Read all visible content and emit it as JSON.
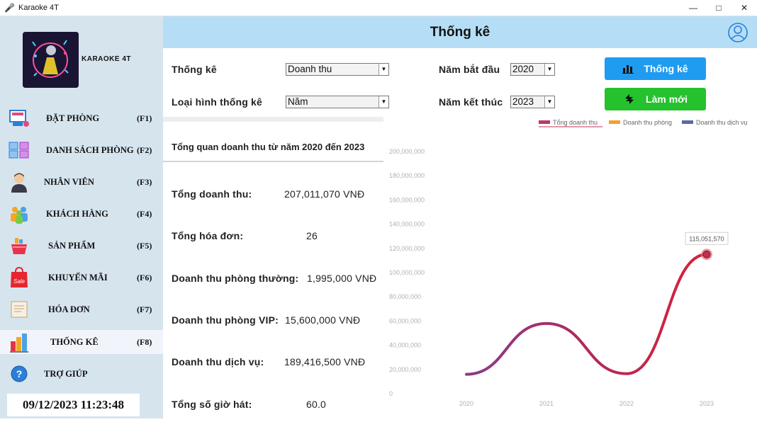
{
  "window": {
    "title": "Karaoke 4T",
    "minimize": "—",
    "maximize": "□",
    "close": "✕"
  },
  "sidebar": {
    "brand": "KARAOKE 4T",
    "items": [
      {
        "label": "ĐẶT PHÒNG",
        "key": "(F1)",
        "icon": "booking-icon"
      },
      {
        "label": "DANH SÁCH PHÒNG",
        "key": "(F2)",
        "icon": "room-list-icon"
      },
      {
        "label": "NHÂN VIÊN",
        "key": "(F3)",
        "icon": "employee-icon"
      },
      {
        "label": "KHÁCH HÀNG",
        "key": "(F4)",
        "icon": "customer-icon"
      },
      {
        "label": "SẢN PHẨM",
        "key": "(F5)",
        "icon": "product-icon"
      },
      {
        "label": "KHUYẾN MÃI",
        "key": "(F6)",
        "icon": "sale-icon"
      },
      {
        "label": "HÓA ĐƠN",
        "key": "(F7)",
        "icon": "invoice-icon"
      },
      {
        "label": "THỐNG KÊ",
        "key": "(F8)",
        "icon": "statistics-icon",
        "active": true
      },
      {
        "label": "TRỢ GIÚP",
        "key": "",
        "icon": "help-icon"
      }
    ],
    "clock": "09/12/2023 11:23:48"
  },
  "header": {
    "title": "Thống kê",
    "user_icon": "user-icon"
  },
  "filters": {
    "type_label": "Thống kê",
    "type_value": "Doanh thu",
    "kind_label": "Loại hình thống kê",
    "kind_value": "Năm",
    "start_label": "Năm bắt đầu",
    "start_value": "2020",
    "end_label": "Năm kết thúc",
    "end_value": "2023",
    "stats_button": "Thống kê",
    "refresh_button": "Làm mới"
  },
  "summary": {
    "title": "Tổng quan doanh thu từ năm 2020 đến 2023",
    "rows": [
      {
        "label": "Tổng doanh thu:",
        "value": "207,011,070 VNĐ"
      },
      {
        "label": "Tổng hóa đơn:",
        "value": "26"
      },
      {
        "label": "Doanh thu phòng thường:",
        "value": "1,995,000 VNĐ"
      },
      {
        "label": "Doanh thu phòng VIP:",
        "value": "15,600,000 VNĐ"
      },
      {
        "label": "Doanh thu dịch vụ:",
        "value": "189,416,500 VNĐ"
      },
      {
        "label": "Tổng số giờ hát:",
        "value": "60.0"
      }
    ]
  },
  "chart_data": {
    "type": "line",
    "categories": [
      "2020",
      "2021",
      "2022",
      "2023"
    ],
    "series": [
      {
        "name": "Tổng doanh thu",
        "color": "#c0304f",
        "values": [
          16000000,
          58000000,
          16500000,
          115051570
        ]
      }
    ],
    "legend": [
      {
        "name": "Tổng doanh thu",
        "color": "#b83a6a"
      },
      {
        "name": "Doanh thu phòng",
        "color": "#f0a030"
      },
      {
        "name": "Doanh thu dịch vụ",
        "color": "#5a6aa8"
      }
    ],
    "y_ticks": [
      "0",
      "20,000,000",
      "40,000,000",
      "60,000,000",
      "80,000,000",
      "100,000,000",
      "120,000,000",
      "140,000,000",
      "160,000,000",
      "180,000,000",
      "200,000,000"
    ],
    "ylim": [
      0,
      200000000
    ],
    "highlight_label": "115,051,570",
    "legend_position": "top-right",
    "grid": false
  }
}
